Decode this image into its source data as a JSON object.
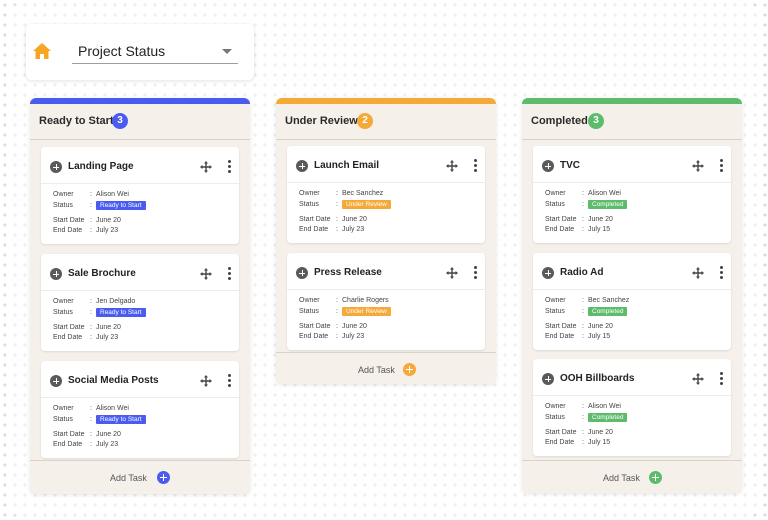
{
  "header": {
    "home_icon": "home-icon",
    "project_select_value": "Project Status"
  },
  "labels": {
    "owner": "Owner",
    "status": "Status",
    "start_date": "Start Date",
    "end_date": "End Date",
    "colon": ":"
  },
  "columns": [
    {
      "title": "Ready to Start",
      "count": "3",
      "accent": "#4a5cf0",
      "status_color": "#4a5cf0",
      "add_task": "Add Task",
      "cards": [
        {
          "title": "Landing Page",
          "owner": "Alison Wei",
          "status": "Ready to Start",
          "start": "June 20",
          "end": "July 23"
        },
        {
          "title": "Sale Brochure",
          "owner": "Jen Delgado",
          "status": "Ready to Start",
          "start": "June 20",
          "end": "July 23"
        },
        {
          "title": "Social Media Posts",
          "owner": "Alison Wei",
          "status": "Ready to Start",
          "start": "June 20",
          "end": "July 23"
        }
      ]
    },
    {
      "title": "Under Review",
      "count": "2",
      "accent": "#f5a938",
      "status_color": "#f5a938",
      "add_task": "Add Task",
      "cards": [
        {
          "title": "Launch Email",
          "owner": "Bec Sanchez",
          "status": "Under Review",
          "start": "June 20",
          "end": "July 23"
        },
        {
          "title": "Press Release",
          "owner": "Charlie Rogers",
          "status": "Under Review",
          "start": "June 20",
          "end": "July 23"
        }
      ]
    },
    {
      "title": "Completed",
      "count": "3",
      "accent": "#5cbc6c",
      "status_color": "#5cbc6c",
      "add_task": "Add Task",
      "cards": [
        {
          "title": "TVC",
          "owner": "Alison Wei",
          "status": "Completed",
          "start": "June 20",
          "end": "July 15"
        },
        {
          "title": "Radio Ad",
          "owner": "Bec Sanchez",
          "status": "Completed",
          "start": "June 20",
          "end": "July 15"
        },
        {
          "title": "OOH Billboards",
          "owner": "Alison Wei",
          "status": "Completed",
          "start": "June 20",
          "end": "July 15"
        }
      ]
    }
  ]
}
